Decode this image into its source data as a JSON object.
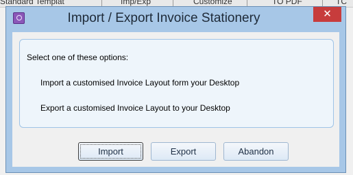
{
  "background_app": {
    "cells": [
      "Standard Templat",
      "Imp/Exp",
      "Customize",
      "TO PDF",
      "TC"
    ]
  },
  "dialog": {
    "title": "Import / Export Invoice Stationery",
    "close_glyph": "✕",
    "prompt": "Select one of these options:",
    "options": [
      {
        "label": "Import a customised Invoice Layout form your Desktop"
      },
      {
        "label": "Export a customised Invoice Layout to your Desktop"
      }
    ],
    "buttons": {
      "import": "Import",
      "export": "Export",
      "abandon": "Abandon"
    }
  },
  "colors": {
    "frame": "#a7c7e7",
    "close_button": "#c73c3c",
    "panel_border": "#9ec3e6"
  },
  "icons": {
    "app": "app-icon",
    "close": "close-icon"
  }
}
